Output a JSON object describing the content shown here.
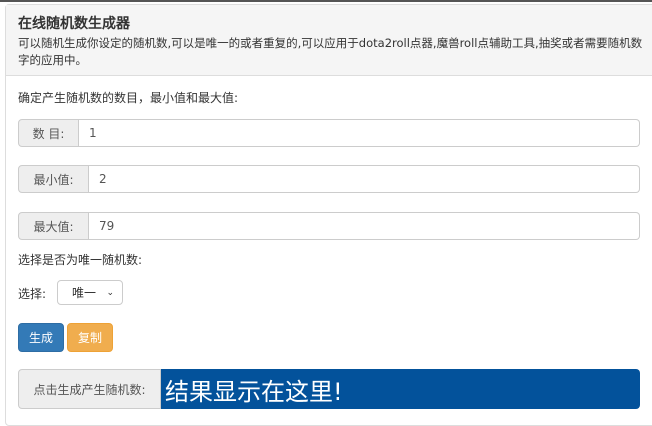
{
  "header": {
    "title": "在线随机数生成器",
    "description": "可以随机生成你设定的随机数,可以是唯一的或者重复的,可以应用于dota2roll点器,魔兽roll点辅助工具,抽奖或者需要随机数字的应用中。"
  },
  "form": {
    "intro": "确定产生随机数的数目，最小值和最大值:",
    "count": {
      "label": "数 目:",
      "value": "1"
    },
    "min": {
      "label": "最小值:",
      "value": "2"
    },
    "max": {
      "label": "最大值:",
      "value": "79"
    },
    "unique_prompt": "选择是否为唯一随机数:",
    "select_label": "选择:",
    "select_value": "唯一",
    "generate_label": "生成",
    "copy_label": "复制",
    "result_label": "点击生成产生随机数:",
    "result_value": "结果显示在这里!"
  },
  "colors": {
    "primary": "#337ab7",
    "warning": "#f0ad4e",
    "result_bg": "#03529b"
  }
}
